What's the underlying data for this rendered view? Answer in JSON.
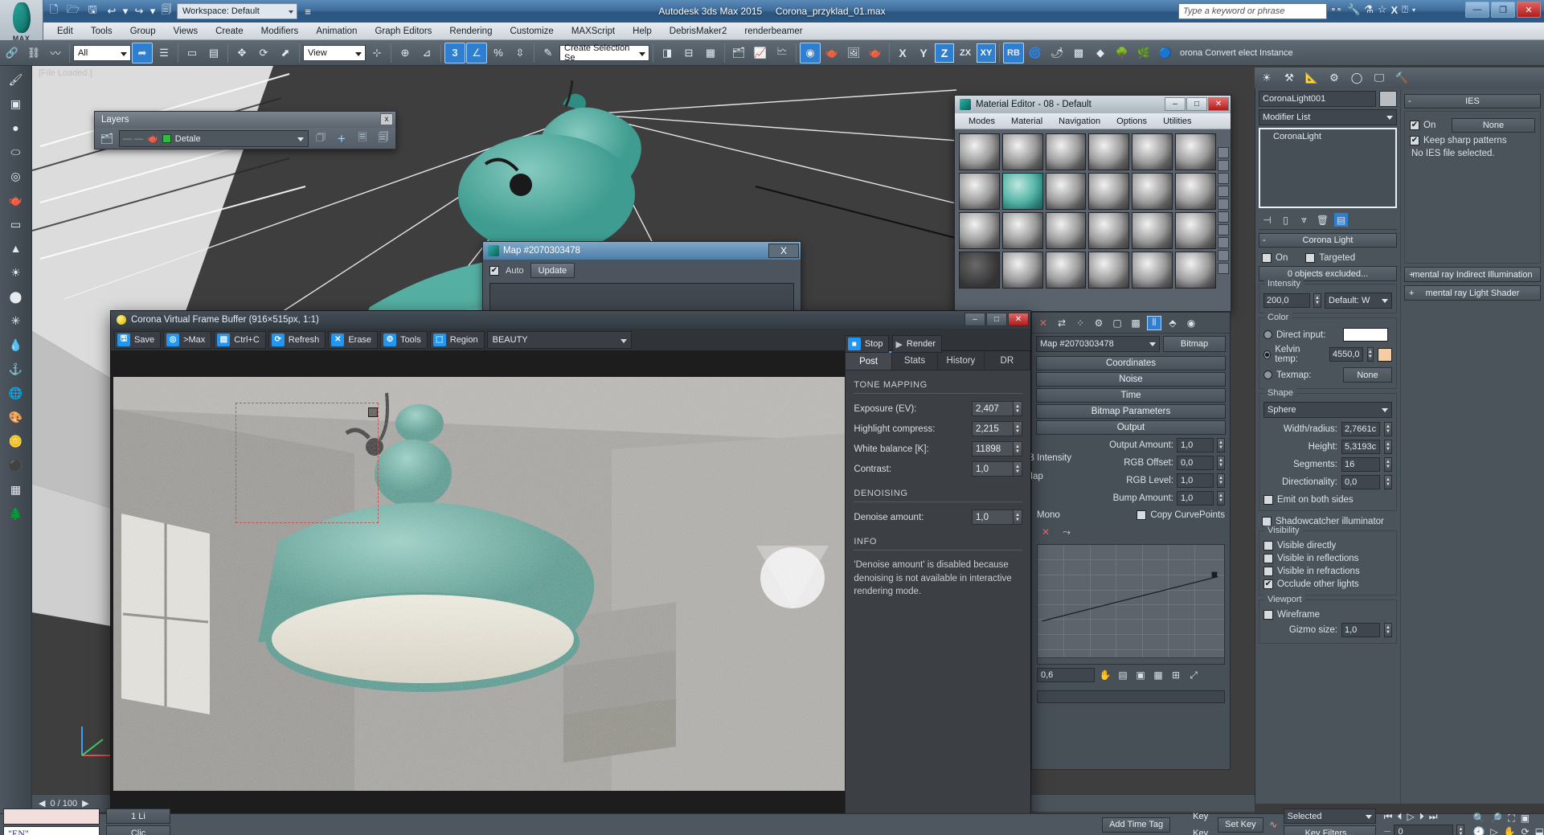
{
  "app": {
    "title": "Autodesk 3ds Max 2015",
    "file": "Corona_przyklad_01.max",
    "workspace": "Workspace: Default",
    "search_placeholder": "Type a keyword or phrase",
    "logo_text": "MAX"
  },
  "menu": [
    "Edit",
    "Tools",
    "Group",
    "Views",
    "Create",
    "Modifiers",
    "Animation",
    "Graph Editors",
    "Rendering",
    "Customize",
    "MAXScript",
    "Help",
    "DebrisMaker2",
    "renderbeamer"
  ],
  "toolbar": {
    "filter_value": "All",
    "ref_coord": "View",
    "selection_set_placeholder": "Create Selection Se",
    "axis_x": "X",
    "axis_y": "Y",
    "axis_z": "Z",
    "axis_zx": "ZX",
    "axis_xy": "XY",
    "rb_label": "RB",
    "corona_convert": "orona Convert elect Instance",
    "count_label": "3"
  },
  "viewport": {
    "label": "[File Loaded.]",
    "frame_ticks": "0 / 100"
  },
  "layers": {
    "title": "Layers",
    "current_layer": "Detale",
    "close_label": "x"
  },
  "map_dialog": {
    "title": "Map #2070303478",
    "auto_label": "Auto",
    "update_label": "Update",
    "close_label": "X",
    "auto_checked": true
  },
  "material_editor": {
    "title": "Material Editor - 08 - Default",
    "menu": [
      "Modes",
      "Material",
      "Navigation",
      "Options",
      "Utilities"
    ],
    "minimize": "–",
    "maximize": "□",
    "close": "✕",
    "slots": [
      {
        "style": "grey"
      },
      {
        "style": "grey"
      },
      {
        "style": "grey"
      },
      {
        "style": "grey"
      },
      {
        "style": "grey"
      },
      {
        "style": "grey"
      },
      {
        "style": "grey"
      },
      {
        "style": "teal"
      },
      {
        "style": "grey"
      },
      {
        "style": "grey"
      },
      {
        "style": "grey"
      },
      {
        "style": "grey"
      },
      {
        "style": "grey"
      },
      {
        "style": "grey"
      },
      {
        "style": "grey"
      },
      {
        "style": "grey"
      },
      {
        "style": "grey"
      },
      {
        "style": "grey"
      },
      {
        "style": "dark"
      },
      {
        "style": "grey"
      },
      {
        "style": "grey"
      },
      {
        "style": "grey"
      },
      {
        "style": "grey"
      },
      {
        "style": "grey"
      }
    ]
  },
  "vfb": {
    "title": "Corona Virtual Frame Buffer (916×515px, 1:1)",
    "minimize": "–",
    "maximize": "□",
    "close": "✕",
    "toolbar": [
      {
        "label": "Save",
        "icon": "save-icon"
      },
      {
        "label": ">Max",
        "icon": "to-max-icon"
      },
      {
        "label": "Ctrl+C",
        "icon": "copy-icon"
      },
      {
        "label": "Refresh",
        "icon": "refresh-icon"
      },
      {
        "label": "Erase",
        "icon": "erase-icon"
      },
      {
        "label": "Tools",
        "icon": "gear-icon"
      },
      {
        "label": "Region",
        "icon": "region-icon"
      }
    ],
    "pass": "BEAUTY",
    "stop_label": "Stop",
    "render_label": "Render",
    "tabs": [
      {
        "label": "Post",
        "active": true
      },
      {
        "label": "Stats",
        "active": false
      },
      {
        "label": "History",
        "active": false
      },
      {
        "label": "DR",
        "active": false
      }
    ],
    "tone_mapping": {
      "header": "TONE MAPPING",
      "rows": [
        {
          "label": "Exposure (EV):",
          "value": "2,407"
        },
        {
          "label": "Highlight compress:",
          "value": "2,215"
        },
        {
          "label": "White balance [K]:",
          "value": "11898"
        },
        {
          "label": "Contrast:",
          "value": "1,0"
        }
      ]
    },
    "denoising": {
      "header": "DENOISING",
      "rows": [
        {
          "label": "Denoise amount:",
          "value": "1,0"
        }
      ]
    },
    "info": {
      "header": "INFO",
      "text": "'Denoise amount' is disabled because denoising is not available in interactive rendering mode."
    }
  },
  "map_panel": {
    "map_name": "Map #2070303478",
    "type_button": "Bitmap",
    "rollups": [
      "Coordinates",
      "Noise",
      "Time",
      "Bitmap Parameters",
      "Output"
    ],
    "output_rows": [
      {
        "label": "Output Amount:",
        "value": "1,0"
      },
      {
        "label": "RGB Offset:",
        "value": "0,0"
      },
      {
        "label": "RGB Level:",
        "value": "1,0"
      },
      {
        "label": "Bump Amount:",
        "value": "1,0"
      }
    ],
    "left_labels": [
      "RGB Intensity",
      "or Map",
      "Mono"
    ],
    "copy_curvepoints": "Copy CurvePoints",
    "bottom_value": "0,6"
  },
  "command_panel": {
    "object_name": "CoronaLight001",
    "modifier_list": "Modifier List",
    "stack_items": [
      "CoronaLight"
    ],
    "ies": {
      "title": "IES",
      "collapse": "-",
      "on_label": "On",
      "on_checked": true,
      "none_button": "None",
      "keep_sharp": "Keep sharp patterns",
      "keep_sharp_checked": true,
      "no_file": "No IES file selected."
    },
    "mental_ray": [
      "mental ray Indirect Illumination",
      "mental ray Light Shader"
    ],
    "corona_light": {
      "title": "Corona Light",
      "collapse": "-",
      "on_label": "On",
      "on_checked": false,
      "targeted_label": "Targeted",
      "targeted_checked": false,
      "exclude_button": "0 objects excluded...",
      "intensity_group": "Intensity",
      "intensity_value": "200,0",
      "intensity_unit": "Default: W",
      "color_group": "Color",
      "direct_input_label": "Direct input:",
      "kelvin_label": "Kelvin temp:",
      "kelvin_value": "4550,0",
      "texmap_label": "Texmap:",
      "texmap_value": "None",
      "color_mode": "kelvin",
      "shape_group": "Shape",
      "shape_value": "Sphere",
      "shape_rows": [
        {
          "label": "Width/radius:",
          "value": "2,7661c"
        },
        {
          "label": "Height:",
          "value": "5,3193c"
        },
        {
          "label": "Segments:",
          "value": "16"
        },
        {
          "label": "Directionality:",
          "value": "0,0"
        }
      ],
      "emit_both": "Emit on both sides",
      "emit_both_checked": false,
      "shadowcatcher": "Shadowcatcher illuminator",
      "shadowcatcher_checked": false,
      "visibility_group": "Visibility",
      "visibility": [
        {
          "label": "Visible directly",
          "checked": false
        },
        {
          "label": "Visible in reflections",
          "checked": false
        },
        {
          "label": "Visible in refractions",
          "checked": false
        },
        {
          "label": "Occlude other lights",
          "checked": true
        }
      ],
      "viewport_group": "Viewport",
      "wireframe": "Wireframe",
      "wireframe_checked": false,
      "gizmo_label": "Gizmo size:",
      "gizmo_value": "1,0"
    }
  },
  "status_bar": {
    "lang": "\"EN\"",
    "light_count": "1 Li",
    "click_hint": "Clic",
    "add_time_tag": "Add Time Tag",
    "set_key": "Set Key",
    "key_label": "Key",
    "auto_key": "Key",
    "selected": "Selected",
    "key_filters": "Key Filters...",
    "frame": "0"
  }
}
